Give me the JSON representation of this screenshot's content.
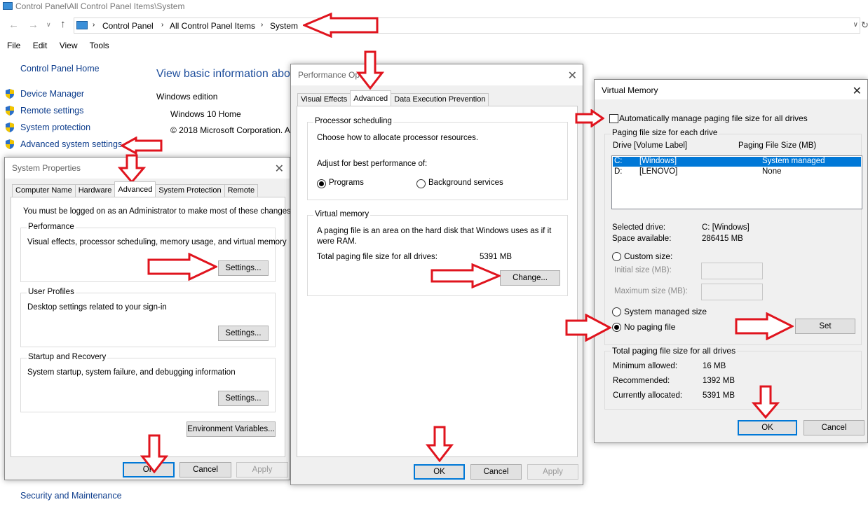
{
  "window": {
    "title": "Control Panel\\All Control Panel Items\\System"
  },
  "address": {
    "crumbs": [
      "Control Panel",
      "All Control Panel Items",
      "System"
    ]
  },
  "menubar": [
    "File",
    "Edit",
    "View",
    "Tools"
  ],
  "sidebar": {
    "home": "Control Panel Home",
    "items": [
      "Device Manager",
      "Remote settings",
      "System protection",
      "Advanced system settings"
    ],
    "footer": "Security and Maintenance"
  },
  "main": {
    "heading": "View basic information abo",
    "edition_label": "Windows edition",
    "edition": "Windows 10 Home",
    "copyright": "© 2018 Microsoft Corporation. A"
  },
  "sysprops": {
    "title": "System Properties",
    "tabs": [
      "Computer Name",
      "Hardware",
      "Advanced",
      "System Protection",
      "Remote"
    ],
    "notice": "You must be logged on as an Administrator to make most of these changes.",
    "performance": {
      "label": "Performance",
      "desc": "Visual effects, processor scheduling, memory usage, and virtual memory",
      "button": "Settings..."
    },
    "profiles": {
      "label": "User Profiles",
      "desc": "Desktop settings related to your sign-in",
      "button": "Settings..."
    },
    "startup": {
      "label": "Startup and Recovery",
      "desc": "System startup, system failure, and debugging information",
      "button": "Settings..."
    },
    "env_button": "Environment Variables...",
    "ok": "OK",
    "cancel": "Cancel",
    "apply": "Apply"
  },
  "perfopts": {
    "title": "Performance Options",
    "tabs": [
      "Visual Effects",
      "Advanced",
      "Data Execution Prevention"
    ],
    "sched": {
      "label": "Processor scheduling",
      "desc": "Choose how to allocate processor resources.",
      "adjust": "Adjust for best performance of:",
      "programs": "Programs",
      "background": "Background services"
    },
    "vm": {
      "label": "Virtual memory",
      "desc1": "A paging file is an area on the hard disk that Windows uses as if it",
      "desc2": "were RAM.",
      "total_label": "Total paging file size for all drives:",
      "total_value": "5391 MB",
      "change": "Change..."
    },
    "ok": "OK",
    "cancel": "Cancel",
    "apply": "Apply"
  },
  "vmem": {
    "title": "Virtual Memory",
    "auto": "Automatically manage paging file size for all drives",
    "each_label": "Paging file size for each drive",
    "col_drive": "Drive  [Volume Label]",
    "col_size": "Paging File Size (MB)",
    "rows": [
      {
        "drive": "C:",
        "label": "[Windows]",
        "size": "System managed"
      },
      {
        "drive": "D:",
        "label": "[LENOVO]",
        "size": "None"
      }
    ],
    "selected_label": "Selected drive:",
    "selected_value": "C:  [Windows]",
    "space_label": "Space available:",
    "space_value": "286415 MB",
    "custom": "Custom size:",
    "initial": "Initial size (MB):",
    "maximum": "Maximum size (MB):",
    "system_managed": "System managed size",
    "no_paging": "No paging file",
    "set": "Set",
    "total_label": "Total paging file size for all drives",
    "min_label": "Minimum allowed:",
    "min_value": "16 MB",
    "rec_label": "Recommended:",
    "rec_value": "1392 MB",
    "cur_label": "Currently allocated:",
    "cur_value": "5391 MB",
    "ok": "OK",
    "cancel": "Cancel"
  },
  "colors": {
    "accent": "#0078d7",
    "annotation": "#e0141e",
    "link": "#0c3c8c"
  }
}
